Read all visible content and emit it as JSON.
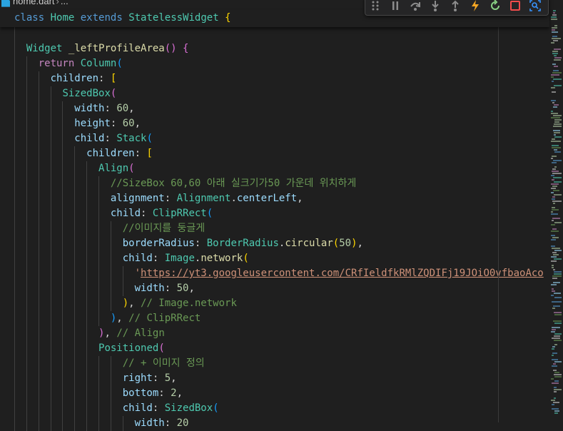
{
  "breadcrumb": {
    "file": "home.dart",
    "separator": "›",
    "more": "..."
  },
  "sticky": [
    {
      "t": "class",
      "c": "keyword"
    },
    {
      "t": " ",
      "c": "plain"
    },
    {
      "t": "Home",
      "c": "type"
    },
    {
      "t": " ",
      "c": "plain"
    },
    {
      "t": "extends",
      "c": "keyword"
    },
    {
      "t": " ",
      "c": "plain"
    },
    {
      "t": "StatelessWidget",
      "c": "type"
    },
    {
      "t": " ",
      "c": "plain"
    },
    {
      "t": "{",
      "c": "b1"
    }
  ],
  "code": [
    [
      {
        "t": "  ",
        "c": "plain"
      },
      {
        "t": "Widget",
        "c": "type"
      },
      {
        "t": " ",
        "c": "plain"
      },
      {
        "t": "_leftProfileArea",
        "c": "func"
      },
      {
        "t": "()",
        "c": "b2"
      },
      {
        "t": " ",
        "c": "plain"
      },
      {
        "t": "{",
        "c": "b2"
      }
    ],
    [
      {
        "t": "    ",
        "c": "plain"
      },
      {
        "t": "return",
        "c": "control"
      },
      {
        "t": " ",
        "c": "plain"
      },
      {
        "t": "Column",
        "c": "type"
      },
      {
        "t": "(",
        "c": "b3"
      }
    ],
    [
      {
        "t": "      ",
        "c": "plain"
      },
      {
        "t": "children",
        "c": "param"
      },
      {
        "t": ": ",
        "c": "plain"
      },
      {
        "t": "[",
        "c": "b1"
      }
    ],
    [
      {
        "t": "        ",
        "c": "plain"
      },
      {
        "t": "SizedBox",
        "c": "type"
      },
      {
        "t": "(",
        "c": "b2"
      }
    ],
    [
      {
        "t": "          ",
        "c": "plain"
      },
      {
        "t": "width",
        "c": "param"
      },
      {
        "t": ": ",
        "c": "plain"
      },
      {
        "t": "60",
        "c": "number"
      },
      {
        "t": ",",
        "c": "plain"
      }
    ],
    [
      {
        "t": "          ",
        "c": "plain"
      },
      {
        "t": "height",
        "c": "param"
      },
      {
        "t": ": ",
        "c": "plain"
      },
      {
        "t": "60",
        "c": "number"
      },
      {
        "t": ",",
        "c": "plain"
      }
    ],
    [
      {
        "t": "          ",
        "c": "plain"
      },
      {
        "t": "child",
        "c": "param"
      },
      {
        "t": ": ",
        "c": "plain"
      },
      {
        "t": "Stack",
        "c": "type"
      },
      {
        "t": "(",
        "c": "b3"
      }
    ],
    [
      {
        "t": "            ",
        "c": "plain"
      },
      {
        "t": "children",
        "c": "param"
      },
      {
        "t": ": ",
        "c": "plain"
      },
      {
        "t": "[",
        "c": "b1"
      }
    ],
    [
      {
        "t": "              ",
        "c": "plain"
      },
      {
        "t": "Align",
        "c": "type"
      },
      {
        "t": "(",
        "c": "b2"
      }
    ],
    [
      {
        "t": "                ",
        "c": "plain"
      },
      {
        "t": "//SizeBox 60,60 아래 실크기가50 가운데 위치하게",
        "c": "comment"
      }
    ],
    [
      {
        "t": "                ",
        "c": "plain"
      },
      {
        "t": "alignment",
        "c": "param"
      },
      {
        "t": ": ",
        "c": "plain"
      },
      {
        "t": "Alignment",
        "c": "type"
      },
      {
        "t": ".",
        "c": "plain"
      },
      {
        "t": "centerLeft",
        "c": "param"
      },
      {
        "t": ",",
        "c": "plain"
      }
    ],
    [
      {
        "t": "                ",
        "c": "plain"
      },
      {
        "t": "child",
        "c": "param"
      },
      {
        "t": ": ",
        "c": "plain"
      },
      {
        "t": "ClipRRect",
        "c": "type"
      },
      {
        "t": "(",
        "c": "b3"
      }
    ],
    [
      {
        "t": "                  ",
        "c": "plain"
      },
      {
        "t": "//이미지를 둥글게",
        "c": "comment"
      }
    ],
    [
      {
        "t": "                  ",
        "c": "plain"
      },
      {
        "t": "borderRadius",
        "c": "param"
      },
      {
        "t": ": ",
        "c": "plain"
      },
      {
        "t": "BorderRadius",
        "c": "type"
      },
      {
        "t": ".",
        "c": "plain"
      },
      {
        "t": "circular",
        "c": "func"
      },
      {
        "t": "(",
        "c": "b1"
      },
      {
        "t": "50",
        "c": "number"
      },
      {
        "t": ")",
        "c": "b1"
      },
      {
        "t": ",",
        "c": "plain"
      }
    ],
    [
      {
        "t": "                  ",
        "c": "plain"
      },
      {
        "t": "child",
        "c": "param"
      },
      {
        "t": ": ",
        "c": "plain"
      },
      {
        "t": "Image",
        "c": "type"
      },
      {
        "t": ".",
        "c": "plain"
      },
      {
        "t": "network",
        "c": "func"
      },
      {
        "t": "(",
        "c": "b1"
      }
    ],
    [
      {
        "t": "                    ",
        "c": "plain"
      },
      {
        "t": "'",
        "c": "string"
      },
      {
        "t": "https://yt3.googleusercontent.com/CRfIeldfkRMlZQDIFj19JOiO0vfbaoAco",
        "c": "url"
      }
    ],
    [
      {
        "t": "                    ",
        "c": "plain"
      },
      {
        "t": "width",
        "c": "param"
      },
      {
        "t": ": ",
        "c": "plain"
      },
      {
        "t": "50",
        "c": "number"
      },
      {
        "t": ",",
        "c": "plain"
      }
    ],
    [
      {
        "t": "                  ",
        "c": "plain"
      },
      {
        "t": ")",
        "c": "b1"
      },
      {
        "t": ", ",
        "c": "plain"
      },
      {
        "t": "// Image.network",
        "c": "comment"
      }
    ],
    [
      {
        "t": "                ",
        "c": "plain"
      },
      {
        "t": ")",
        "c": "b3"
      },
      {
        "t": ", ",
        "c": "plain"
      },
      {
        "t": "// ClipRRect",
        "c": "comment"
      }
    ],
    [
      {
        "t": "              ",
        "c": "plain"
      },
      {
        "t": ")",
        "c": "b2"
      },
      {
        "t": ", ",
        "c": "plain"
      },
      {
        "t": "// Align",
        "c": "comment"
      }
    ],
    [
      {
        "t": "              ",
        "c": "plain"
      },
      {
        "t": "Positioned",
        "c": "type"
      },
      {
        "t": "(",
        "c": "b2"
      }
    ],
    [
      {
        "t": "                  ",
        "c": "plain"
      },
      {
        "t": "// + 이미지 정의",
        "c": "comment"
      }
    ],
    [
      {
        "t": "                  ",
        "c": "plain"
      },
      {
        "t": "right",
        "c": "param"
      },
      {
        "t": ": ",
        "c": "plain"
      },
      {
        "t": "5",
        "c": "number"
      },
      {
        "t": ",",
        "c": "plain"
      }
    ],
    [
      {
        "t": "                  ",
        "c": "plain"
      },
      {
        "t": "bottom",
        "c": "param"
      },
      {
        "t": ": ",
        "c": "plain"
      },
      {
        "t": "2",
        "c": "number"
      },
      {
        "t": ",",
        "c": "plain"
      }
    ],
    [
      {
        "t": "                  ",
        "c": "plain"
      },
      {
        "t": "child",
        "c": "param"
      },
      {
        "t": ": ",
        "c": "plain"
      },
      {
        "t": "SizedBox",
        "c": "type"
      },
      {
        "t": "(",
        "c": "b3"
      }
    ],
    [
      {
        "t": "                    ",
        "c": "plain"
      },
      {
        "t": "width",
        "c": "param"
      },
      {
        "t": ": ",
        "c": "plain"
      },
      {
        "t": "20",
        "c": "number"
      }
    ]
  ],
  "toolbar": {
    "buttons": [
      {
        "name": "drag-handle-icon",
        "color": "#8c8c8c"
      },
      {
        "name": "pause-icon",
        "color": "#8c8c8c"
      },
      {
        "name": "step-over-icon",
        "color": "#8c8c8c"
      },
      {
        "name": "step-into-icon",
        "color": "#8c8c8c"
      },
      {
        "name": "step-out-icon",
        "color": "#8c8c8c"
      },
      {
        "name": "hot-reload-icon",
        "color": "#f5a623"
      },
      {
        "name": "hot-restart-icon",
        "color": "#89d185"
      },
      {
        "name": "stop-icon",
        "color": "#f14c4c"
      },
      {
        "name": "inspect-widget-icon",
        "color": "#3794ff"
      }
    ]
  },
  "colors": {
    "background": "#1f1f1f",
    "indent_guide": "#404040",
    "ruler": "#3a3a3a"
  }
}
